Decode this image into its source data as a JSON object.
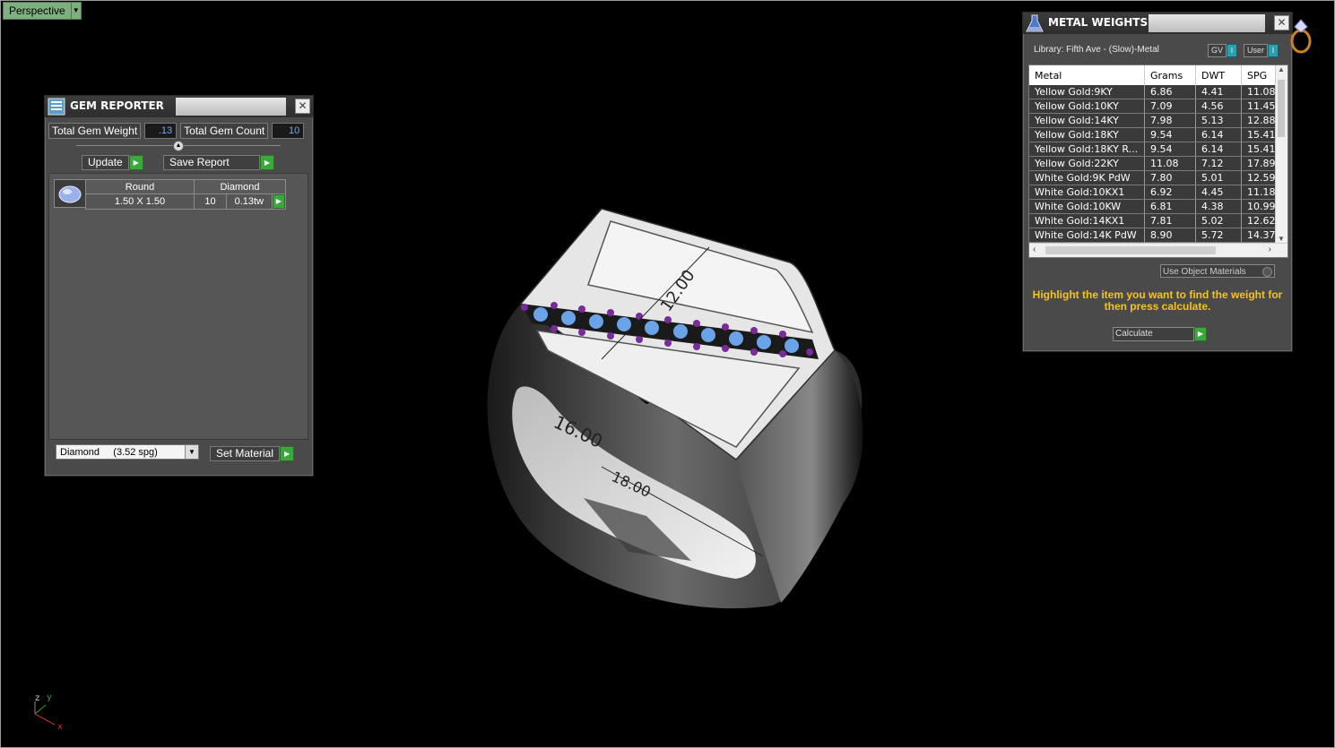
{
  "viewport": {
    "label": "Perspective"
  },
  "gem_reporter": {
    "title": "GEM REPORTER",
    "total_weight_label": "Total Gem Weight",
    "total_weight_value": ".13",
    "total_count_label": "Total Gem Count",
    "total_count_value": "10",
    "update_label": "Update",
    "save_report_label": "Save Report",
    "row": {
      "shape": "Round",
      "material": "Diamond",
      "size": "1.50 X 1.50",
      "count": "10",
      "weight": "0.13tw"
    },
    "material_select": "Diamond     (3.52 spg)",
    "set_material_label": "Set Material"
  },
  "metal_weights": {
    "title": "METAL WEIGHTS",
    "library": "Library: Fifth Ave - (Slow)-Metal",
    "toggle_gv": "GV",
    "toggle_user": "User",
    "columns": [
      "Metal",
      "Grams",
      "DWT",
      "SPG"
    ],
    "rows": [
      [
        "Yellow Gold:9KY",
        "6.86",
        "4.41",
        "11.08"
      ],
      [
        "Yellow Gold:10KY",
        "7.09",
        "4.56",
        "11.45"
      ],
      [
        "Yellow Gold:14KY",
        "7.98",
        "5.13",
        "12.88"
      ],
      [
        "Yellow Gold:18KY",
        "9.54",
        "6.14",
        "15.41"
      ],
      [
        "Yellow Gold:18KY R...",
        "9.54",
        "6.14",
        "15.41"
      ],
      [
        "Yellow Gold:22KY",
        "11.08",
        "7.12",
        "17.89"
      ],
      [
        "White Gold:9K PdW",
        "7.80",
        "5.01",
        "12.59"
      ],
      [
        "White Gold:10KX1",
        "6.92",
        "4.45",
        "11.18"
      ],
      [
        "White Gold:10KW",
        "6.81",
        "4.38",
        "10.99"
      ],
      [
        "White Gold:14KX1",
        "7.81",
        "5.02",
        "12.62"
      ],
      [
        "White Gold:14K PdW",
        "8.90",
        "5.72",
        "14.37"
      ]
    ],
    "use_object_materials": "Use Object Materials",
    "hint": "Highlight the item you want to find the weight for then press calculate.",
    "calculate_label": "Calculate"
  },
  "model": {
    "dimension_labels": [
      "12.00",
      "16.00",
      "18.00"
    ]
  },
  "axes": {
    "z": "z",
    "y": "y",
    "x": "x"
  }
}
